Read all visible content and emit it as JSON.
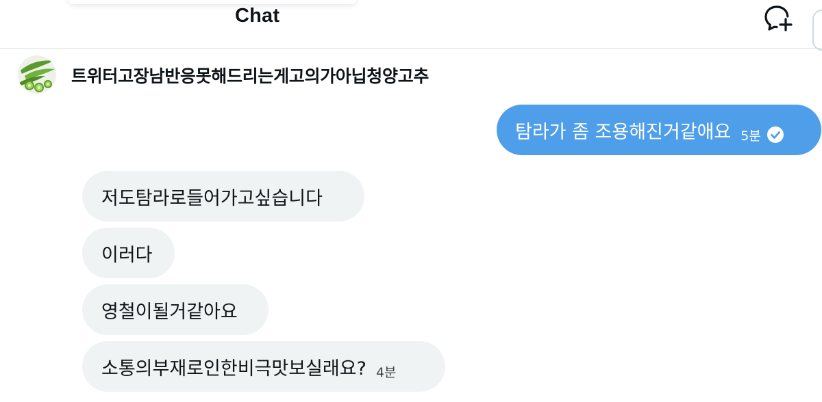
{
  "header": {
    "title": "Chat",
    "new_chat_icon": "new-message-icon"
  },
  "conversation": {
    "peer_name": "트위터고장남반응못해드리는게고의가아닙청양고추",
    "avatar_icon": "green-pepper-avatar"
  },
  "messages": [
    {
      "direction": "sent",
      "text": "탐라가 좀 조용해진거같애요",
      "time": "5분",
      "status_icon": "read-check-icon"
    },
    {
      "direction": "received",
      "text": "저도탐라로들어가고싶습니다"
    },
    {
      "direction": "received",
      "text": "이러다"
    },
    {
      "direction": "received",
      "text": "영철이될거같아요"
    },
    {
      "direction": "received",
      "text": "소통의부재로인한비극맛보실래요?",
      "time": "4분"
    }
  ],
  "colors": {
    "sent_bubble": "#4e9eea",
    "received_bubble": "#eff3f4",
    "text": "#0f1419"
  }
}
